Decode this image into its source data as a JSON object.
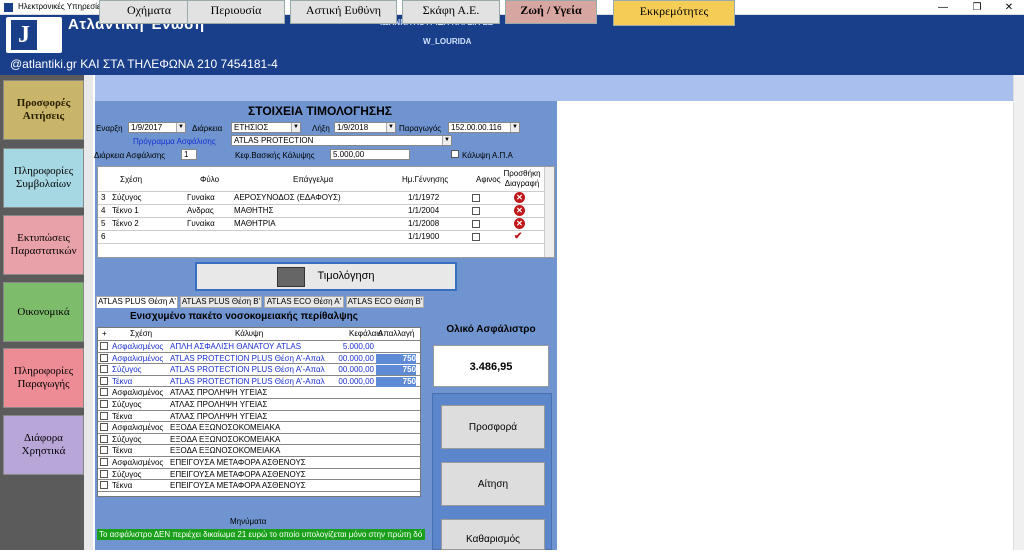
{
  "window": {
    "title": "Ηλεκτρονικές Υπηρεσίες ΑΤΛΑΝΤΙΚΗΣ ΕΝΩΣΗΣ",
    "minimize": "—",
    "maximize": "❐",
    "close": "✕"
  },
  "header": {
    "logo_letter": "J",
    "brand": "Ατλαντική Ένωση",
    "company": "ΙΩΑΝΝΑ ΛΟΥΡΙΔΑ ΚΑΙ ΣΙΑ ΕΕ",
    "user": "W_LOURIDA",
    "phone": "@atlantiki.gr ΚΑΙ ΣΤΑ ΤΗΛΕΦΩΝΑ 210 7454181-4"
  },
  "sidebar": {
    "items": [
      {
        "label": "Προσφορές Αιτήσεις",
        "color": "#c9b56a"
      },
      {
        "label": "Πληροφορίες Συμβολαίων",
        "color": "#a6d8e4"
      },
      {
        "label": "Εκτυπώσεις Παραστατικών",
        "color": "#e8a1a8"
      },
      {
        "label": "Οικονομικά",
        "color": "#7dbc6b"
      },
      {
        "label": "Πληροφορίες Παραγωγής",
        "color": "#ee8c95"
      },
      {
        "label": "Διάφορα Χρηστικά",
        "color": "#b8a6d8"
      }
    ]
  },
  "tabs": [
    {
      "label": "Οχήματα",
      "color": "#e2e2e2"
    },
    {
      "label": "Περιουσία",
      "color": "#e2e2e2"
    },
    {
      "label": "Αστική Ευθύνη",
      "color": "#e2e2e2"
    },
    {
      "label": "Σκάφη Α.Ε.",
      "color": "#e2e2e2"
    },
    {
      "label": "Ζωή / Υγεία",
      "color": "#d7a6a0"
    },
    {
      "label": "Εκκρεμότητες",
      "color": "#f5cc55"
    }
  ],
  "billing": {
    "title": "ΣΤΟΙΧΕΙΑ ΤΙΜΟΛΟΓΗΣΗΣ",
    "start_label": "Εναρξη",
    "start": "1/9/2017",
    "duration_label": "Διάρκεια",
    "duration": "ΕΤΗΣΙΟΣ",
    "end_label": "Λήξη",
    "end": "1/9/2018",
    "producer_label": "Παραγωγός",
    "producer": "152.00.00.116",
    "program_label": "Πρόγραμμα Ασφάλισης",
    "program": "ATLAS PROTECTION",
    "ins_duration_label": "Διάρκεια Ασφάλισης",
    "ins_duration": "1",
    "capital_label": "Κεφ.Βασικής Κάλυψης",
    "capital": "5.000,00",
    "apa_label": "Κάλυψη Α.Π.Α"
  },
  "insured": {
    "columns": [
      "Σχέση",
      "Φύλο",
      "Επάγγελμα",
      "Ημ.Γέννησης",
      "Αφινος",
      "Προσθήκη Διαγραφή"
    ],
    "rows": [
      {
        "n": "3",
        "relation": "Σύζυγος",
        "gender": "Γυναίκα",
        "job": "ΑΕΡΟΣΥΝΟΔΟΣ (ΕΔΑΦΟΥΣ)",
        "dob": "1/1/1972",
        "action": "✕"
      },
      {
        "n": "4",
        "relation": "Τέκνο 1",
        "gender": "Ανδρας",
        "job": "ΜΑΘΗΤΗΣ",
        "dob": "1/1/2004",
        "action": "✕"
      },
      {
        "n": "5",
        "relation": "Τέκνο 2",
        "gender": "Γυναίκα",
        "job": "ΜΑΘΗΤΡΙΑ",
        "dob": "1/1/2008",
        "action": "✕"
      },
      {
        "n": "6",
        "relation": "",
        "gender": "",
        "job": "",
        "dob": "1/1/1900",
        "action": "✔"
      }
    ]
  },
  "calc_button": "Τιμολόγηση",
  "subtabs": [
    "ATLAS PLUS Θέση Α'",
    "ATLAS PLUS Θέση Β'",
    "ATLAS ECO Θέση Α'",
    "ATLAS ECO Θέση Β'"
  ],
  "package": {
    "title": "Ενισχυμένο πακέτο νοσοκομειακής περίθαλψης",
    "columns": {
      "plus": "+",
      "relation": "Σχέση",
      "coverage": "Κάλυψη",
      "capital": "Κεφάλαιο",
      "deductible": "Απαλλαγή"
    },
    "rows": [
      {
        "relation": "Ασφαλισμένος",
        "coverage": "ΑΠΛΗ ΑΣΦΑΛΙΣΗ ΘΑΝΑΤΟΥ ATLAS",
        "capital": "5.000,00",
        "ded": "",
        "blue": true
      },
      {
        "relation": "Ασφαλισμένος",
        "coverage": "ATLAS PROTECTION PLUS    Θέση Α'-Απαλ",
        "capital": "00.000,00",
        "ded": "750",
        "blue": true
      },
      {
        "relation": "Σύζυγος",
        "coverage": "ATLAS PROTECTION PLUS    Θέση Α'-Απαλ",
        "capital": "00.000,00",
        "ded": "750",
        "blue": true
      },
      {
        "relation": "Τέκνα",
        "coverage": "ATLAS PROTECTION PLUS    Θέση Α'-Απαλ",
        "capital": "00.000,00",
        "ded": "750",
        "blue": true
      },
      {
        "relation": "Ασφαλισμένος",
        "coverage": "ΑΤΛΑΣ ΠΡΟΛΗΨΗ ΥΓΕΙΑΣ",
        "capital": "",
        "ded": ""
      },
      {
        "relation": "Σύζυγος",
        "coverage": "ΑΤΛΑΣ ΠΡΟΛΗΨΗ ΥΓΕΙΑΣ",
        "capital": "",
        "ded": ""
      },
      {
        "relation": "Τέκνα",
        "coverage": "ΑΤΛΑΣ ΠΡΟΛΗΨΗ ΥΓΕΙΑΣ",
        "capital": "",
        "ded": ""
      },
      {
        "relation": "Ασφαλισμένος",
        "coverage": "ΕΞΟΔΑ ΕΞΩΝΟΣΟΚΟΜΕΙΑΚΑ",
        "capital": "",
        "ded": ""
      },
      {
        "relation": "Σύζυγος",
        "coverage": "ΕΞΟΔΑ ΕΞΩΝΟΣΟΚΟΜΕΙΑΚΑ",
        "capital": "",
        "ded": ""
      },
      {
        "relation": "Τέκνα",
        "coverage": "ΕΞΟΔΑ ΕΞΩΝΟΣΟΚΟΜΕΙΑΚΑ",
        "capital": "",
        "ded": ""
      },
      {
        "relation": "Ασφαλισμένος",
        "coverage": "ΕΠΕΙΓΟΥΣΑ ΜΕΤΑΦΟΡΑ ΑΣΘΕΝΟΥΣ",
        "capital": "",
        "ded": ""
      },
      {
        "relation": "Σύζυγος",
        "coverage": "ΕΠΕΙΓΟΥΣΑ ΜΕΤΑΦΟΡΑ ΑΣΘΕΝΟΥΣ",
        "capital": "",
        "ded": ""
      },
      {
        "relation": "Τέκνα",
        "coverage": "ΕΠΕΙΓΟΥΣΑ ΜΕΤΑΦΟΡΑ ΑΣΘΕΝΟΥΣ",
        "capital": "",
        "ded": ""
      }
    ]
  },
  "messages": {
    "label": "Μηνύματα",
    "text": "Το ασφάλιστρο ΔΕΝ περιέχει δικαίωμα 21 ευρώ το οποίο υπολογίζεται μόνο στην πρώτη δό"
  },
  "total": {
    "label": "Ολικό Ασφάλιστρο",
    "value": "3.486,95"
  },
  "actions": {
    "offer": "Προσφορά",
    "application": "Αίτηση",
    "clear": "Καθαρισμός"
  }
}
